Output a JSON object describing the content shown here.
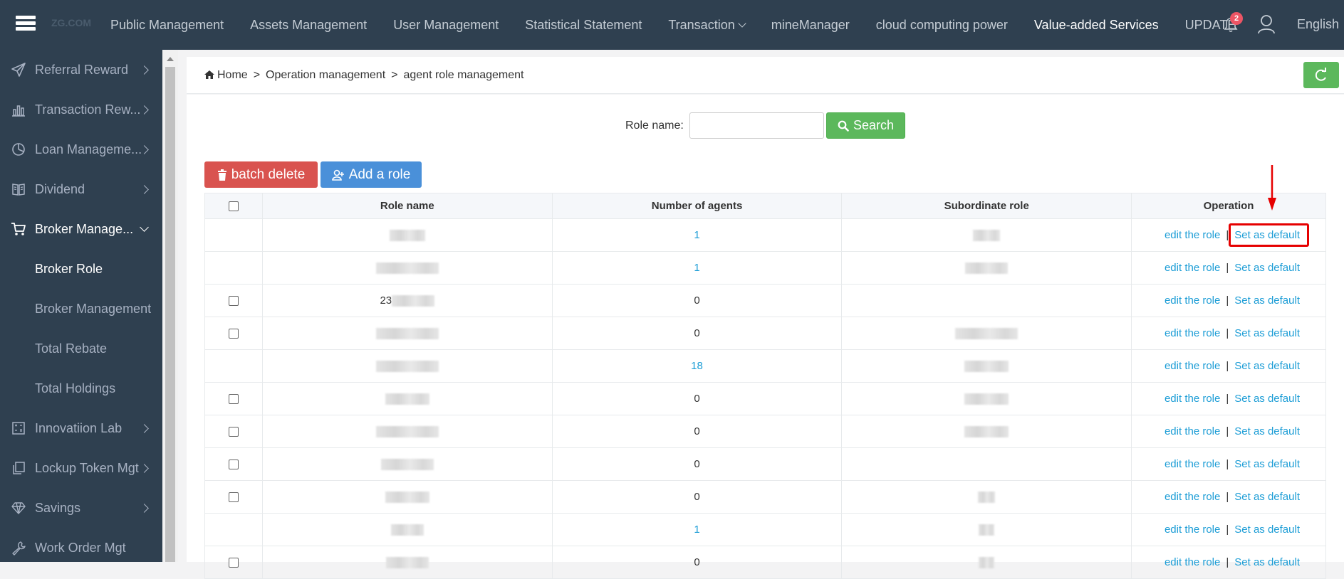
{
  "topnav": {
    "logo": "ZG.COM",
    "items": [
      {
        "label": "Public Management"
      },
      {
        "label": "Assets Management"
      },
      {
        "label": "User Management"
      },
      {
        "label": "Statistical Statement"
      },
      {
        "label": "Transaction"
      },
      {
        "label": "mineManager"
      },
      {
        "label": "cloud computing power"
      },
      {
        "label": "Value-added Services"
      },
      {
        "label": "UPDATE"
      }
    ],
    "notification_count": "2",
    "language": "English"
  },
  "sidebar": {
    "items": [
      {
        "label": "Referral Reward",
        "icon": "send-icon"
      },
      {
        "label": "Transaction Rew...",
        "icon": "bar-chart-icon"
      },
      {
        "label": "Loan Manageme...",
        "icon": "pie-chart-icon"
      },
      {
        "label": "Dividend",
        "icon": "book-icon"
      },
      {
        "label": "Broker Manage...",
        "icon": "cart-icon"
      },
      {
        "label": "Innovatiion Lab",
        "icon": "calculator-icon"
      },
      {
        "label": "Lockup Token Mgt",
        "icon": "copy-icon"
      },
      {
        "label": "Savings",
        "icon": "diamond-icon"
      },
      {
        "label": "Work Order Mgt",
        "icon": "wrench-icon"
      }
    ],
    "subitems": [
      {
        "label": "Broker Role"
      },
      {
        "label": "Broker Management"
      },
      {
        "label": "Total Rebate"
      },
      {
        "label": "Total Holdings"
      }
    ]
  },
  "breadcrumb": {
    "home": "Home",
    "level1": "Operation management",
    "level2": "agent role management",
    "separator": ">"
  },
  "search": {
    "label": "Role name:",
    "value": "",
    "placeholder": "",
    "button": "Search"
  },
  "actions": {
    "batch_delete": "batch delete",
    "add_role": "Add a role"
  },
  "table": {
    "headers": [
      "Role name",
      "Number of agents",
      "Subordinate role",
      "Operation"
    ],
    "op_edit": "edit the role",
    "op_sep": "|",
    "op_default": "Set as default",
    "rows": [
      {
        "has_checkbox": false,
        "role": "",
        "agents": "1",
        "agents_link": true
      },
      {
        "has_checkbox": false,
        "role": "",
        "agents": "1",
        "agents_link": true
      },
      {
        "has_checkbox": true,
        "role": "23",
        "agents": "0",
        "agents_link": false
      },
      {
        "has_checkbox": true,
        "role": "",
        "agents": "0",
        "agents_link": false
      },
      {
        "has_checkbox": false,
        "role": "",
        "agents": "18",
        "agents_link": true
      },
      {
        "has_checkbox": true,
        "role": "",
        "agents": "0",
        "agents_link": false
      },
      {
        "has_checkbox": true,
        "role": "",
        "agents": "0",
        "agents_link": false
      },
      {
        "has_checkbox": true,
        "role": "",
        "agents": "0",
        "agents_link": false
      },
      {
        "has_checkbox": true,
        "role": "",
        "agents": "0",
        "agents_link": false
      },
      {
        "has_checkbox": false,
        "role": "",
        "agents": "1",
        "agents_link": true
      },
      {
        "has_checkbox": true,
        "role": "",
        "agents": "0",
        "agents_link": false
      }
    ]
  },
  "colors": {
    "nav_bg": "#2f4050",
    "green": "#5cb85c",
    "red": "#d9534f",
    "blue": "#4a90d9",
    "link": "#1c9dd6",
    "annotation": "#e60000"
  }
}
